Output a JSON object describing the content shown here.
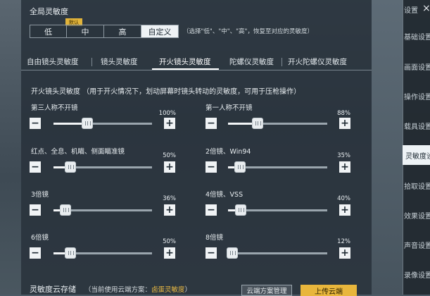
{
  "global": {
    "title": "全局灵敏度",
    "presets": [
      {
        "label": "低",
        "active": false
      },
      {
        "label": "中",
        "active": false
      },
      {
        "label": "高",
        "active": false
      },
      {
        "label": "自定义",
        "active": true
      }
    ],
    "default_tag": "默认",
    "hint": "（选择\"低\"、\"中\"、\"高\"，恢复至对应的灵敏度）"
  },
  "tabs": [
    {
      "label": "自由镜头灵敏度",
      "active": false
    },
    {
      "label": "镜头灵敏度",
      "active": false
    },
    {
      "label": "开火镜头灵敏度",
      "active": true
    },
    {
      "label": "陀螺仪灵敏度",
      "active": false
    },
    {
      "label": "开火陀螺仪灵敏度",
      "active": false
    }
  ],
  "section_desc": "开火镜头灵敏度 （用于开火情况下，划动屏幕时镜头转动的灵敏度，可用于压枪操作）",
  "sliders": [
    {
      "label": "第三人称不开镜",
      "percent_text": "100%",
      "value": 0.34
    },
    {
      "label": "第一人称不开镜",
      "percent_text": "88%",
      "value": 0.3
    },
    {
      "label": "红点、全息、机瞄、侧面瞄准镜",
      "percent_text": "50%",
      "value": 0.17
    },
    {
      "label": "2倍镜、Win94",
      "percent_text": "35%",
      "value": 0.12
    },
    {
      "label": "3倍镜",
      "percent_text": "36%",
      "value": 0.12
    },
    {
      "label": "4倍镜、VSS",
      "percent_text": "40%",
      "value": 0.13
    },
    {
      "label": "6倍镜",
      "percent_text": "50%",
      "value": 0.17
    },
    {
      "label": "8倍镜",
      "percent_text": "12%",
      "value": 0.04
    }
  ],
  "minus_symbol": "−",
  "plus_symbol": "+",
  "cloud": {
    "label": "灵敏度云存储",
    "plan_prefix": "（当前使用云端方案：",
    "plan_name": "卤蛋灵敏度",
    "plan_suffix": "）",
    "manage_button": "云端方案管理",
    "upload_button": "上传云端"
  },
  "sidebar": {
    "header": "设置",
    "close_symbol": "×",
    "items": [
      {
        "label": "基础设置",
        "active": false
      },
      {
        "label": "画面设置",
        "active": false
      },
      {
        "label": "操作设置",
        "active": false
      },
      {
        "label": "载具设置",
        "active": false
      },
      {
        "label": "灵敏度设置",
        "active": true
      },
      {
        "label": "拾取设置",
        "active": false
      },
      {
        "label": "效果设置",
        "active": false
      },
      {
        "label": "声音设置",
        "active": false
      },
      {
        "label": "录像设置",
        "active": false
      }
    ]
  },
  "colors": {
    "accent": "#e8b63c",
    "active_bg": "#eef2f5"
  }
}
